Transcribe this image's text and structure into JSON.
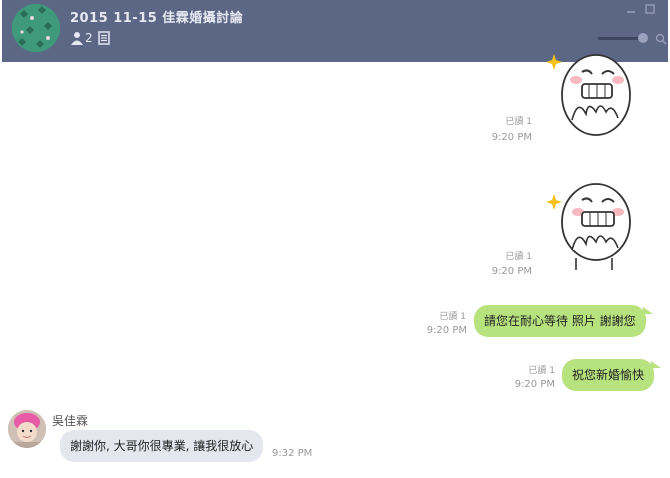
{
  "header": {
    "title": "2015 11-15 佳霖婚攝討論",
    "member_count": "2"
  },
  "messages": [
    {
      "read_label": "已讀 1",
      "time": "9:20 PM"
    },
    {
      "read_label": "已讀 1",
      "time": "9:20 PM"
    },
    {
      "read_label": "已讀 1",
      "time": "9:20 PM",
      "text": "請您在耐心等待  照片  謝謝您"
    },
    {
      "read_label": "已讀 1",
      "time": "9:20 PM",
      "text": "祝您新婚愉快"
    },
    {
      "sender": "吳佳霖",
      "time": "9:32 PM",
      "text": "謝謝你, 大哥你很專業, 讓我很放心"
    }
  ],
  "colors": {
    "header_bg": "#5c6685",
    "my_bubble": "#b7e37e",
    "other_bubble": "#e4e7ee"
  }
}
